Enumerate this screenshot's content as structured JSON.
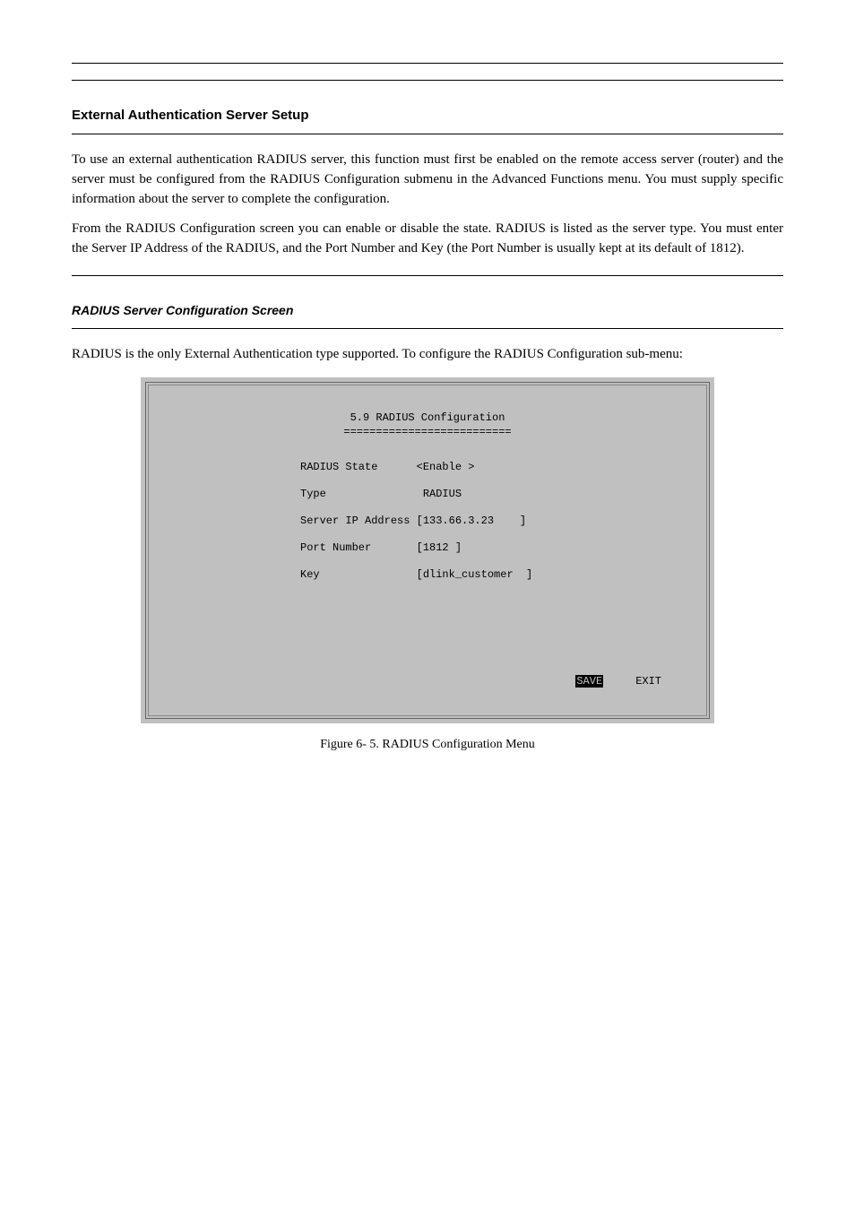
{
  "header": {
    "left": "",
    "right": "",
    "section_heading": "External Authentication Server Setup",
    "config_title": "RADIUS Server Configuration Screen"
  },
  "paragraphs": {
    "intro1": "To use an external authentication RADIUS server, this function must first be enabled on the remote access server (router) and the server must be configured from the RADIUS Configuration submenu in the Advanced Functions menu. You must supply specific information about the server to complete the configuration.",
    "intro2": "From the RADIUS Configuration screen you can enable or disable the state. RADIUS is listed as the server type. You must enter the Server IP Address of the RADIUS, and the Port Number and Key (the Port Number is usually kept at its default of 1812).",
    "config_body": "RADIUS is the only External Authentication type supported. To configure the RADIUS Configuration sub-menu:"
  },
  "terminal": {
    "title": "5.9 RADIUS Configuration",
    "underline": "==========================",
    "rows": {
      "state": {
        "label": "RADIUS State      ",
        "value": "<Enable >"
      },
      "type": {
        "label": "Type              ",
        "value": " RADIUS"
      },
      "ip": {
        "label": "Server IP Address ",
        "value": "[133.66.3.23    ]"
      },
      "port": {
        "label": "Port Number       ",
        "value": "[1812 ]"
      },
      "key": {
        "label": "Key               ",
        "value": "[dlink_customer  ]"
      }
    },
    "actions": {
      "save": "SAVE",
      "exit": "EXIT",
      "spacer": "     "
    }
  },
  "figure_caption": "Figure 6- 5.  RADIUS Configuration Menu",
  "footer": {
    "left": "",
    "right": ""
  }
}
